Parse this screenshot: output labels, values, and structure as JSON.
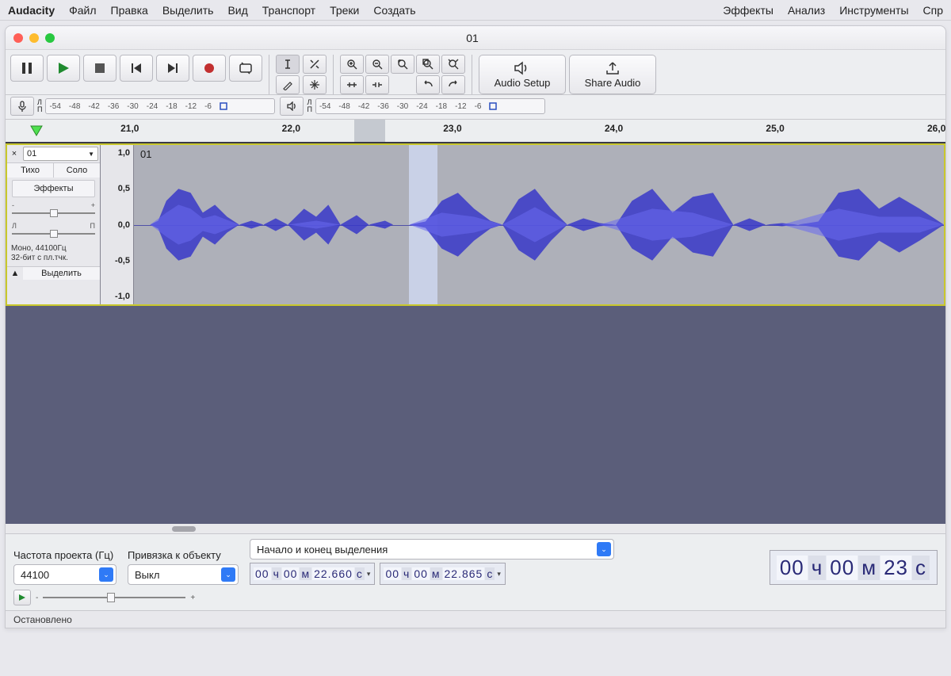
{
  "menubar": {
    "app": "Audacity",
    "left": [
      "Файл",
      "Правка",
      "Выделить",
      "Вид",
      "Транспорт",
      "Треки",
      "Создать"
    ],
    "right": [
      "Эффекты",
      "Анализ",
      "Инструменты",
      "Спр"
    ]
  },
  "window": {
    "title": "01"
  },
  "toolbar": {
    "transport_icons": [
      "pause",
      "play",
      "stop",
      "skip-start",
      "skip-end",
      "record",
      "loop"
    ],
    "tool_icons_row1": [
      "selection-tool",
      "envelope-tool"
    ],
    "tool_icons_row2": [
      "draw-tool",
      "multi-tool"
    ],
    "zoom_icons": [
      "zoom-in",
      "zoom-out",
      "zoom-fit-sel",
      "zoom-fit",
      "zoom-toggle"
    ],
    "editzoom_row2": [
      "trim",
      "silence",
      "",
      "undo",
      "redo"
    ],
    "audio_setup": "Audio Setup",
    "share_audio": "Share Audio"
  },
  "meters": {
    "rec_channels": [
      "Л",
      "П"
    ],
    "play_channels": [
      "Л",
      "П"
    ],
    "db_ticks": [
      "-54",
      "-48",
      "-42",
      "-36",
      "-30",
      "-24",
      "-18",
      "-12",
      "-6",
      "0"
    ],
    "play_db_ticks": [
      "-54",
      "-48",
      "-42",
      "-36",
      "-30",
      "-24",
      "-18",
      "-12",
      "-6",
      "0"
    ]
  },
  "timeline": {
    "labels": [
      "21,0",
      "22,0",
      "23,0",
      "24,0",
      "25,0",
      "26,0"
    ],
    "selection_from_pct": 43.0,
    "selection_to_pct": 46.5
  },
  "track": {
    "name": "01",
    "mute": "Тихо",
    "solo": "Соло",
    "effects": "Эффекты",
    "gain_minus": "-",
    "gain_plus": "+",
    "pan_left": "Л",
    "pan_right": "П",
    "info_line1": "Моно, 44100Гц",
    "info_line2": "32-бит с пл.тчк.",
    "select": "Выделить",
    "y_ticks": [
      "1,0",
      "0,5",
      "0,0",
      "-0,5",
      "-1,0"
    ],
    "clip_label": "01"
  },
  "bottom": {
    "rate_label": "Частота проекта (Гц)",
    "rate_value": "44100",
    "snap_label": "Привязка к объекту",
    "snap_value": "Выкл",
    "selection_label": "Начало и конец выделения",
    "timecode_start": {
      "h": "00",
      "m": "00",
      "s": "22.660",
      "uh": "ч",
      "um": "м",
      "us": "с"
    },
    "timecode_end": {
      "h": "00",
      "m": "00",
      "s": "22.865",
      "uh": "ч",
      "um": "м",
      "us": "с"
    },
    "timecode_pos": {
      "h": "00",
      "m": "00",
      "s": "23",
      "uh": "ч",
      "um": "м",
      "us": "с"
    }
  },
  "status": {
    "text": "Остановлено"
  }
}
